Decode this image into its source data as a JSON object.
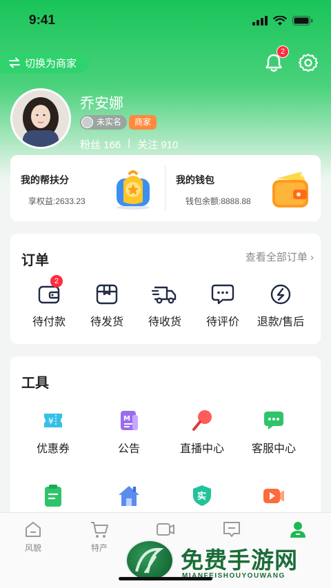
{
  "status_bar": {
    "time": "9:41"
  },
  "header": {
    "switch_label": "切换为商家",
    "notification_count": "2"
  },
  "profile": {
    "name": "乔安娜",
    "verify_tag": "未实名",
    "role_tag": "商家",
    "fans_label": "粉丝 166",
    "follow_label": "关注 910",
    "separator": "|"
  },
  "wallet_card": {
    "support_title": "我的帮扶分",
    "support_sub": "享权益:2633.23",
    "wallet_title": "我的钱包",
    "wallet_sub": "钱包余额:8888.88"
  },
  "orders": {
    "title": "订单",
    "view_all": "查看全部订单 ›",
    "items": [
      {
        "label": "待付款",
        "icon": "wallet-icon",
        "badge": "2"
      },
      {
        "label": "待发货",
        "icon": "package-icon"
      },
      {
        "label": "待收货",
        "icon": "truck-icon"
      },
      {
        "label": "待评价",
        "icon": "comment-icon"
      },
      {
        "label": "退款/售后",
        "icon": "refund-icon"
      }
    ]
  },
  "tools": {
    "title": "工具",
    "items": [
      {
        "label": "优惠券",
        "icon": "coupon-icon",
        "color": "#36c0e8"
      },
      {
        "label": "公告",
        "icon": "notice-icon",
        "color": "#9a6df0"
      },
      {
        "label": "直播中心",
        "icon": "microphone-icon",
        "color": "#ff5b5b"
      },
      {
        "label": "客服中心",
        "icon": "chat-icon",
        "color": "#2fc46a"
      },
      {
        "label": "",
        "icon": "clipboard-icon",
        "color": "#2fc46a"
      },
      {
        "label": "",
        "icon": "house-icon",
        "color": "#5b8def"
      },
      {
        "label": "实",
        "icon": "shield-icon",
        "color": "#23c29a"
      },
      {
        "label": "",
        "icon": "video-icon",
        "color": "#ff6a3d"
      }
    ]
  },
  "tabbar": {
    "items": [
      {
        "label": "风貌",
        "icon": "home-icon"
      },
      {
        "label": "特产",
        "icon": "cart-icon"
      },
      {
        "label": "",
        "icon": "video-tab-icon"
      },
      {
        "label": "",
        "icon": "message-tab-icon"
      },
      {
        "label": "",
        "icon": "profile-tab-icon",
        "active": true
      }
    ]
  },
  "watermark": {
    "title": "免费手游网",
    "subtitle": "MIANFEISHOUYOUWANG"
  },
  "colors": {
    "brand_green": "#19c45a",
    "badge_red": "#ff2b3d",
    "merchant_orange": "#ff8a3d"
  }
}
